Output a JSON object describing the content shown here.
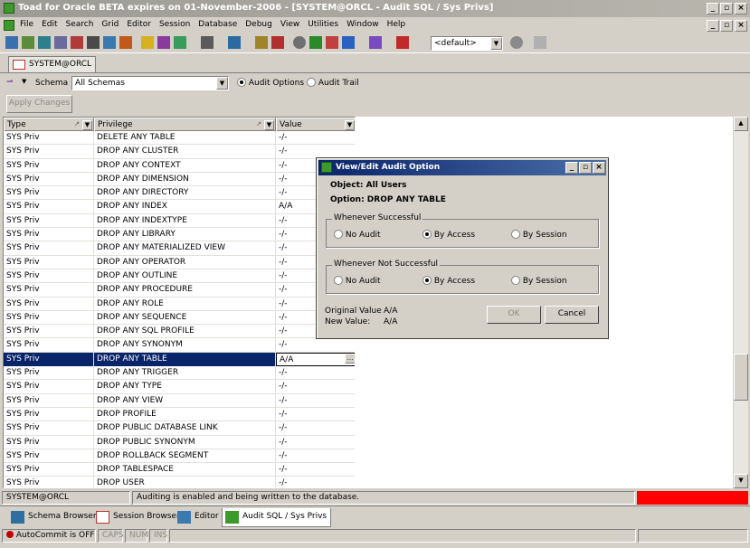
{
  "window": {
    "title": "Toad for Oracle BETA expires on 01-November-2006 - [SYSTEM@ORCL - Audit SQL / Sys Privs]"
  },
  "menu": [
    "File",
    "Edit",
    "Search",
    "Grid",
    "Editor",
    "Session",
    "Database",
    "Debug",
    "View",
    "Utilities",
    "Window",
    "Help"
  ],
  "toolbar": {
    "profile_value": "<default>"
  },
  "connection_tab": {
    "label": "SYSTEM@ORCL"
  },
  "options": {
    "schema_label": "Schema",
    "schema_value": "All Schemas",
    "audit_options_label": "Audit Options",
    "audit_trail_label": "Audit Trail",
    "apply_changes_label": "Apply Changes"
  },
  "grid": {
    "columns": [
      "Type",
      "Privilege",
      "Value"
    ],
    "rows": [
      {
        "type": "SYS Priv",
        "privilege": "DELETE ANY TABLE",
        "value": "-/-"
      },
      {
        "type": "SYS Priv",
        "privilege": "DROP ANY CLUSTER",
        "value": "-/-"
      },
      {
        "type": "SYS Priv",
        "privilege": "DROP ANY CONTEXT",
        "value": "-/-"
      },
      {
        "type": "SYS Priv",
        "privilege": "DROP ANY DIMENSION",
        "value": "-/-"
      },
      {
        "type": "SYS Priv",
        "privilege": "DROP ANY DIRECTORY",
        "value": "-/-"
      },
      {
        "type": "SYS Priv",
        "privilege": "DROP ANY INDEX",
        "value": "A/A"
      },
      {
        "type": "SYS Priv",
        "privilege": "DROP ANY INDEXTYPE",
        "value": "-/-"
      },
      {
        "type": "SYS Priv",
        "privilege": "DROP ANY LIBRARY",
        "value": "-/-"
      },
      {
        "type": "SYS Priv",
        "privilege": "DROP ANY MATERIALIZED VIEW",
        "value": "-/-"
      },
      {
        "type": "SYS Priv",
        "privilege": "DROP ANY OPERATOR",
        "value": "-/-"
      },
      {
        "type": "SYS Priv",
        "privilege": "DROP ANY OUTLINE",
        "value": "-/-"
      },
      {
        "type": "SYS Priv",
        "privilege": "DROP ANY PROCEDURE",
        "value": "-/-"
      },
      {
        "type": "SYS Priv",
        "privilege": "DROP ANY ROLE",
        "value": "-/-"
      },
      {
        "type": "SYS Priv",
        "privilege": "DROP ANY SEQUENCE",
        "value": "-/-"
      },
      {
        "type": "SYS Priv",
        "privilege": "DROP ANY SQL PROFILE",
        "value": "-/-"
      },
      {
        "type": "SYS Priv",
        "privilege": "DROP ANY SYNONYM",
        "value": "-/-"
      },
      {
        "type": "SYS Priv",
        "privilege": "DROP ANY TABLE",
        "value": "A/A",
        "selected": true
      },
      {
        "type": "SYS Priv",
        "privilege": "DROP ANY TRIGGER",
        "value": "-/-"
      },
      {
        "type": "SYS Priv",
        "privilege": "DROP ANY TYPE",
        "value": "-/-"
      },
      {
        "type": "SYS Priv",
        "privilege": "DROP ANY VIEW",
        "value": "-/-"
      },
      {
        "type": "SYS Priv",
        "privilege": "DROP PROFILE",
        "value": "-/-"
      },
      {
        "type": "SYS Priv",
        "privilege": "DROP PUBLIC DATABASE LINK",
        "value": "-/-"
      },
      {
        "type": "SYS Priv",
        "privilege": "DROP PUBLIC SYNONYM",
        "value": "-/-"
      },
      {
        "type": "SYS Priv",
        "privilege": "DROP ROLLBACK SEGMENT",
        "value": "-/-"
      },
      {
        "type": "SYS Priv",
        "privilege": "DROP TABLESPACE",
        "value": "-/-"
      },
      {
        "type": "SYS Priv",
        "privilege": "DROP USER",
        "value": "-/-"
      }
    ]
  },
  "dialog": {
    "title": "View/Edit Audit Option",
    "object_line": "Object:  All Users",
    "option_line": "Option:  DROP ANY TABLE",
    "successful_group": "Whenever Successful",
    "not_successful_group": "Whenever Not Successful",
    "no_audit": "No Audit",
    "by_access": "By Access",
    "by_session": "By Session",
    "original_label": "Original Value",
    "original_value": "A/A",
    "new_label": "New Value:",
    "new_value": "A/A",
    "ok_label": "OK",
    "cancel_label": "Cancel"
  },
  "status": {
    "connection": "SYSTEM@ORCL",
    "message": "Auditing is enabled and being written to the database.",
    "alert_color": "#ff0000"
  },
  "window_tabs": [
    "Schema Browser",
    "Session Browser",
    "Editor",
    "Audit SQL / Sys Privs"
  ],
  "bottom": {
    "autocommit": "AutoCommit is OFF",
    "caps": "CAPS",
    "num": "NUM",
    "ins": "INS"
  },
  "colors": {
    "selection": "#0a246a",
    "title_active": "#0a246a",
    "window_face": "#d4d0c8"
  }
}
